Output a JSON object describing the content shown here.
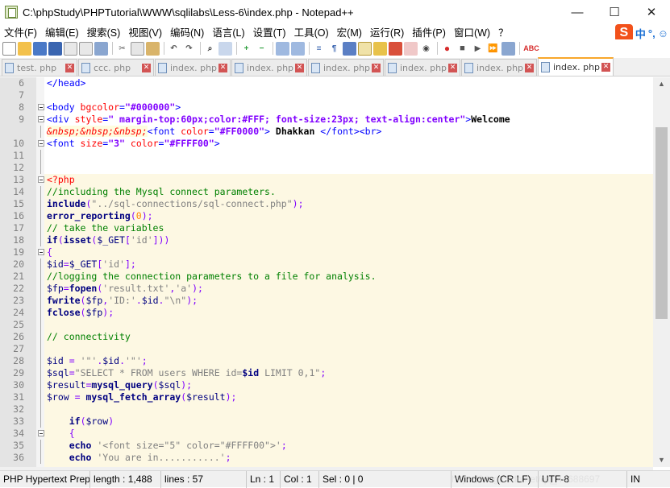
{
  "window": {
    "title": "C:\\phpStudy\\PHPTutorial\\WWW\\sqlilabs\\Less-6\\index.php - Notepad++",
    "minimize": "—",
    "maximize": "☐",
    "close": "✕"
  },
  "menu": [
    "文件(F)",
    "编辑(E)",
    "搜索(S)",
    "视图(V)",
    "编码(N)",
    "语言(L)",
    "设置(T)",
    "工具(O)",
    "宏(M)",
    "运行(R)",
    "插件(P)",
    "窗口(W)",
    "？"
  ],
  "ime": {
    "logo": "S",
    "mode": "中",
    "punct": "°,",
    "extra": "☺"
  },
  "tabs": [
    {
      "label": "test. php",
      "active": false
    },
    {
      "label": "ccc. php",
      "active": false
    },
    {
      "label": "index. php",
      "active": false
    },
    {
      "label": "index. php",
      "active": false
    },
    {
      "label": "index. php",
      "active": false
    },
    {
      "label": "index. php",
      "active": false
    },
    {
      "label": "index. php",
      "active": false
    },
    {
      "label": "index. php",
      "active": true
    }
  ],
  "status": {
    "lang": "PHP Hypertext Prep",
    "length": "length : 1,488",
    "lines": "lines : 57",
    "ln": "Ln : 1",
    "col": "Col : 1",
    "sel": "Sel : 0 | 0",
    "eol": "Windows (CR LF)",
    "enc": "UTF-8",
    "ins": "IN",
    "watermark": "https://blog.csdn.net/qq_44688697"
  },
  "lines": [
    {
      "n": "6",
      "t": "</head>"
    },
    {
      "n": "7",
      "t": ""
    },
    {
      "n": "8",
      "t": "<body bgcolor=\"#000000\">"
    },
    {
      "n": "9",
      "t": "<div style=\" margin-top:60px;color:#FFF; font-size:23px; text-align:center\">Welcome"
    },
    {
      "n": "",
      "t": "&nbsp;&nbsp;&nbsp;<font color=\"#FF0000\"> Dhakkan </font><br>"
    },
    {
      "n": "10",
      "t": "<font size=\"3\" color=\"#FFFF00\">"
    },
    {
      "n": "11",
      "t": ""
    },
    {
      "n": "12",
      "t": ""
    },
    {
      "n": "13",
      "t": "<?php"
    },
    {
      "n": "14",
      "t": "//including the Mysql connect parameters."
    },
    {
      "n": "15",
      "t": "include(\"../sql-connections/sql-connect.php\");"
    },
    {
      "n": "16",
      "t": "error_reporting(0);"
    },
    {
      "n": "17",
      "t": "// take the variables"
    },
    {
      "n": "18",
      "t": "if(isset($_GET['id']))"
    },
    {
      "n": "19",
      "t": "{"
    },
    {
      "n": "20",
      "t": "$id=$_GET['id'];"
    },
    {
      "n": "21",
      "t": "//logging the connection parameters to a file for analysis."
    },
    {
      "n": "22",
      "t": "$fp=fopen('result.txt','a');"
    },
    {
      "n": "23",
      "t": "fwrite($fp,'ID:'.$id.\"\\n\");"
    },
    {
      "n": "24",
      "t": "fclose($fp);"
    },
    {
      "n": "25",
      "t": ""
    },
    {
      "n": "26",
      "t": "// connectivity"
    },
    {
      "n": "27",
      "t": ""
    },
    {
      "n": "28",
      "t": "$id = '\"'.$id.'\"';"
    },
    {
      "n": "29",
      "t": "$sql=\"SELECT * FROM users WHERE id=$id LIMIT 0,1\";"
    },
    {
      "n": "30",
      "t": "$result=mysql_query($sql);"
    },
    {
      "n": "31",
      "t": "$row = mysql_fetch_array($result);"
    },
    {
      "n": "32",
      "t": ""
    },
    {
      "n": "33",
      "t": "    if($row)"
    },
    {
      "n": "34",
      "t": "    {"
    },
    {
      "n": "35",
      "t": "    echo '<font size=\"5\" color=\"#FFFF00\">';"
    },
    {
      "n": "36",
      "t": "    echo 'You are in...........';"
    }
  ]
}
